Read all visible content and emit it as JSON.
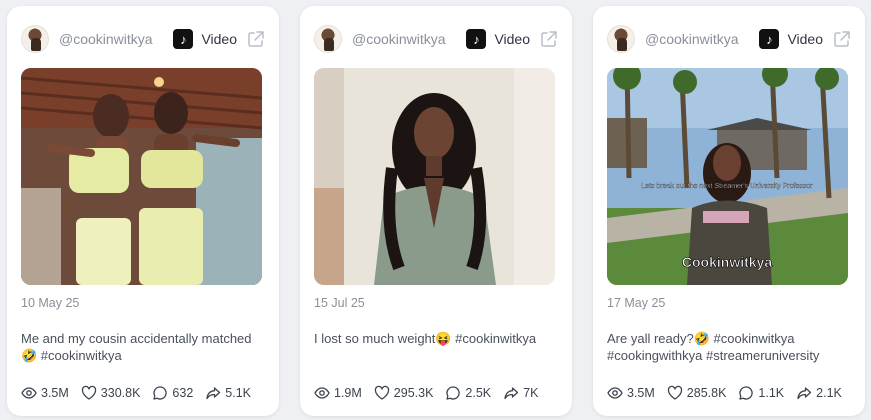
{
  "cards": [
    {
      "handle": "@cookinwitkya",
      "platform_icon": "tiktok-icon",
      "type_label": "Video",
      "date": "10 May 25",
      "caption": "Me and my cousin accidentally matched 🤣 #cookinwitkya",
      "stats": {
        "views": "3.5M",
        "likes": "330.8K",
        "comments": "632",
        "shares": "5.1K"
      }
    },
    {
      "handle": "@cookinwitkya",
      "platform_icon": "tiktok-icon",
      "type_label": "Video",
      "date": "15 Jul 25",
      "caption": "I lost so much weight😝 #cookinwitkya",
      "stats": {
        "views": "1.9M",
        "likes": "295.3K",
        "comments": "2.5K",
        "shares": "7K"
      }
    },
    {
      "handle": "@cookinwitkya",
      "platform_icon": "tiktok-icon",
      "type_label": "Video",
      "date": "17 May 25",
      "caption": "Are yall ready?🤣 #cookinwitkya #cookingwithkya #streameruniversity",
      "thumb_overlay_top": "Lets break out the next Streamer's University Professor",
      "thumb_overlay_name": "Cookinwitkya",
      "stats": {
        "views": "3.5M",
        "likes": "285.8K",
        "comments": "1.1K",
        "shares": "2.1K"
      }
    }
  ],
  "colors": {
    "card_bg": "#ffffff",
    "page_bg": "#eef0f4",
    "muted_text": "#8a8f9a",
    "tiktok": "#111111"
  }
}
